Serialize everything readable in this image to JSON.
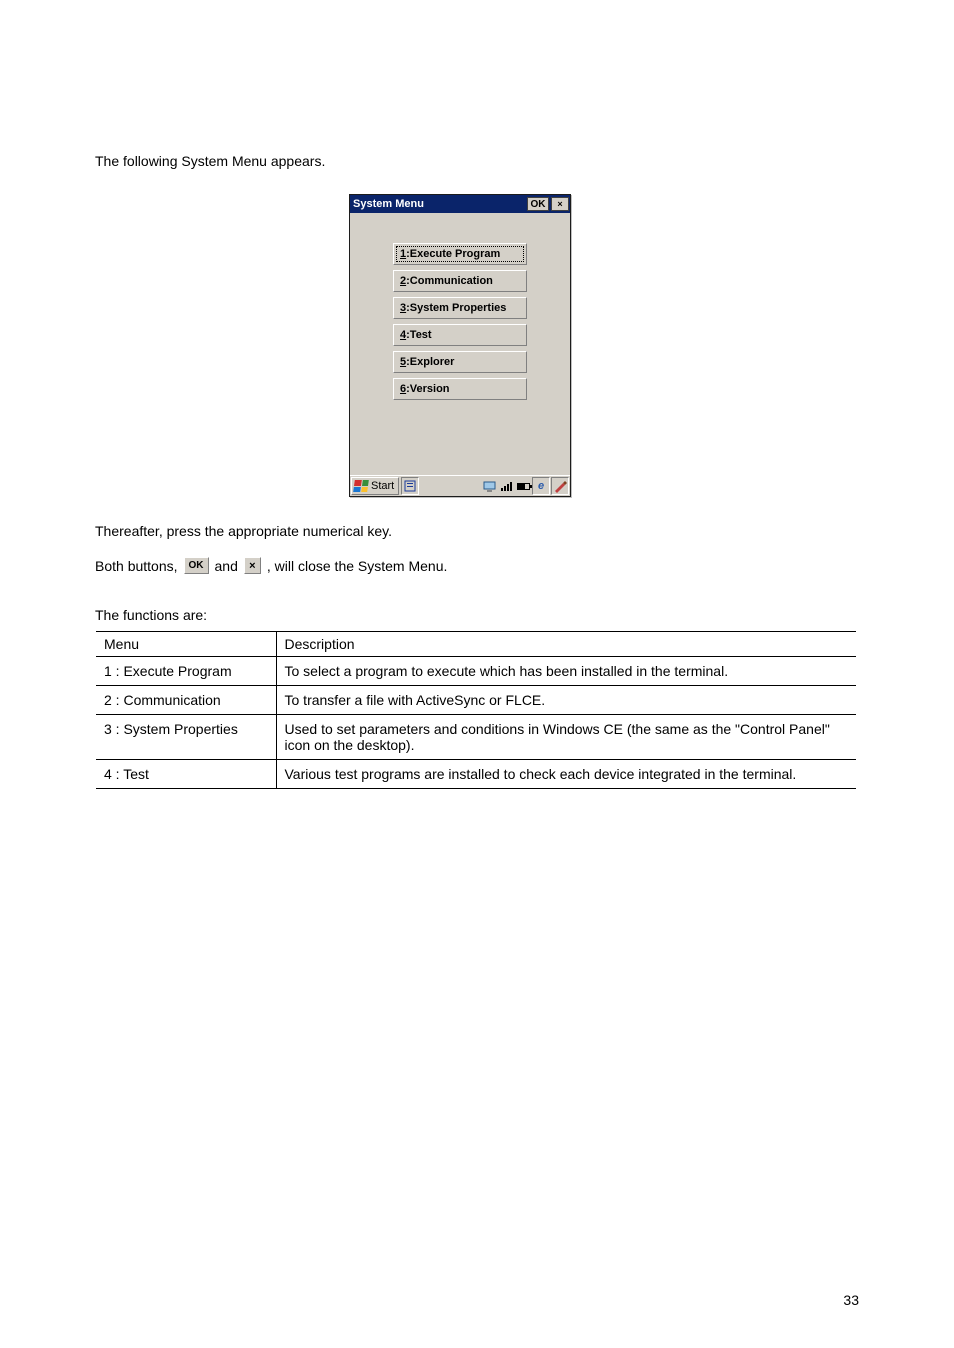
{
  "intro": "The following System Menu appears.",
  "device": {
    "title": "System Menu",
    "ok_label": "OK",
    "close_label": "×",
    "menu_items": [
      {
        "accel": "1",
        "rest": ":Execute Program"
      },
      {
        "accel": "2",
        "rest": ":Communication"
      },
      {
        "accel": "3",
        "rest": ":System Properties"
      },
      {
        "accel": "4",
        "rest": ":Test"
      },
      {
        "accel": "5",
        "rest": ":Explorer"
      },
      {
        "accel": "6",
        "rest": ":Version"
      }
    ],
    "start_label": "Start"
  },
  "note1": "Thereafter, press the appropriate numerical key.",
  "note2_before": "Both buttons,",
  "note2_mid": "and",
  "note2_after": ", will close the System Menu.",
  "functions_label": "The functions are:",
  "table": {
    "header_left": "Menu",
    "header_right": "Description",
    "rows": [
      {
        "left": "1 : Execute Program",
        "right": "To select a program to execute which has been installed in the terminal."
      },
      {
        "left": "2 : Communication",
        "right": "To transfer a file with ActiveSync or FLCE."
      },
      {
        "left": "3 : System Properties",
        "right": "Used to set parameters and conditions in Windows CE (the same as the \"Control Panel\" icon on the desktop)."
      },
      {
        "left": "4 : Test",
        "right": "Various test programs are installed to check each device integrated in the terminal."
      }
    ]
  },
  "page_number": "33"
}
